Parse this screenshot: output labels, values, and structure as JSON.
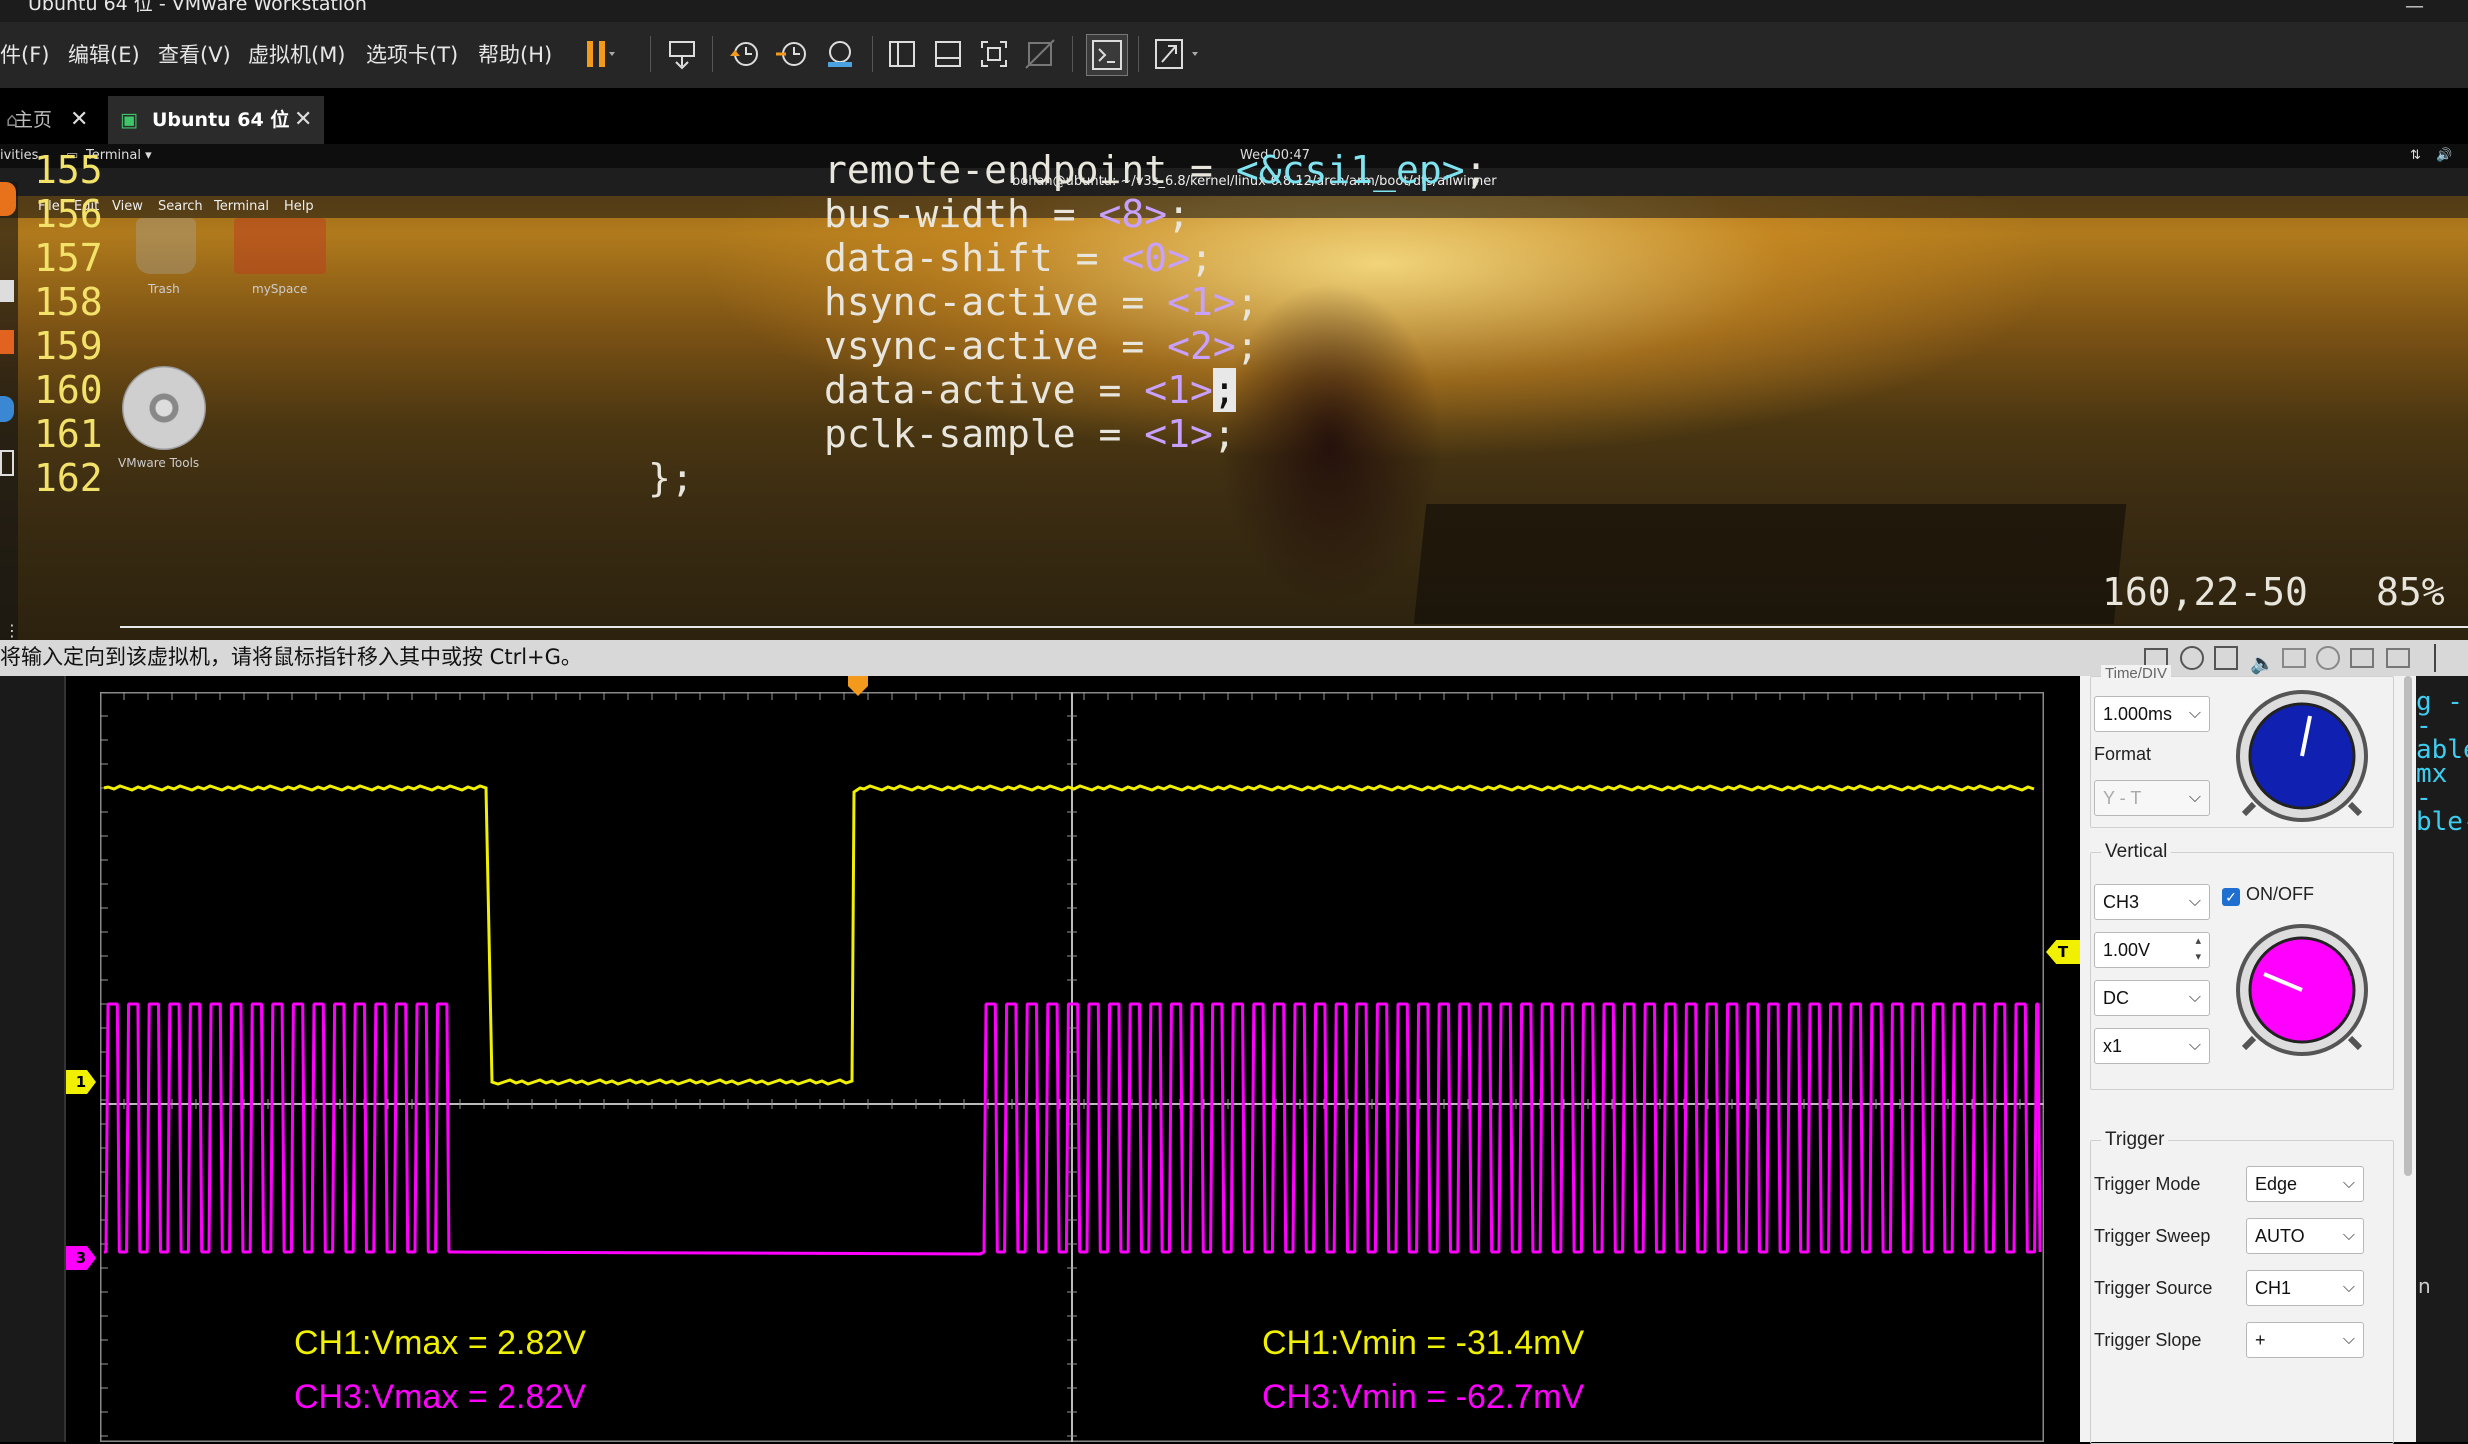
{
  "window": {
    "title": "Ubuntu 64 位 - VMware Workstation",
    "minimize_glyph": "—"
  },
  "menu": [
    "件(F)",
    "编辑(E)",
    "查看(V)",
    "虚拟机(M)",
    "选项卡(T)",
    "帮助(H)"
  ],
  "toolbar_icons": [
    "pause-icon",
    "send-ctrl-alt-del-icon",
    "snapshot-icon",
    "revert-snapshot-icon",
    "snapshot-manager-icon",
    "sidebar-view-icon",
    "thumbnail-view-icon",
    "fullscreen-icon",
    "unity-icon",
    "console-view-icon",
    "stretch-guest-icon"
  ],
  "tabs": [
    {
      "label": "主页",
      "active": false
    },
    {
      "label": "Ubuntu 64 位",
      "active": true
    }
  ],
  "ubuntu": {
    "activities": "ivities",
    "app_menu": "Terminal ▾",
    "clock": "Wed 00:47",
    "terminal_title": "bohan@ubuntu: ~/v3s_6.8/kernel/linux-6.8.12/arch/arm/boot/dts/allwinner",
    "terminal_menu": [
      "File",
      "Edit",
      "View",
      "Search",
      "Terminal",
      "Help"
    ],
    "desktop_icons": [
      "Trash",
      "mySpace",
      "VMware Tools"
    ]
  },
  "editor": {
    "lines": [
      {
        "num": "155",
        "indent": "        ",
        "key": "remote-endpoint = ",
        "val": "<&csi1_ep>",
        "end": ";"
      },
      {
        "num": "156",
        "indent": "        ",
        "key": "bus-width = ",
        "val": "<8>",
        "end": ";"
      },
      {
        "num": "157",
        "indent": "        ",
        "key": "data-shift = ",
        "val": "<0>",
        "end": ";"
      },
      {
        "num": "158",
        "indent": "        ",
        "key": "hsync-active = ",
        "val": "<1>",
        "end": ";"
      },
      {
        "num": "159",
        "indent": "        ",
        "key": "vsync-active = ",
        "val": "<2>",
        "end": ";"
      },
      {
        "num": "160",
        "indent": "        ",
        "key": "data-active = ",
        "val": "<1>",
        "end": ";"
      },
      {
        "num": "161",
        "indent": "        ",
        "key": "pclk-sample = ",
        "val": "<1>",
        "end": ";"
      },
      {
        "num": "162",
        "indent": "",
        "key": "};",
        "val": "",
        "end": ""
      }
    ],
    "position": "160,22-50",
    "percent": "85%"
  },
  "status_hint": "将输入定向到该虚拟机，请将鼠标指针移入其中或按 Ctrl+G。",
  "scope": {
    "ch1_color": "#f0f000",
    "ch3_color": "#ff00ff",
    "markers": {
      "ch1": "1",
      "ch3": "3",
      "trigger": "T"
    },
    "measurements": {
      "ch1_vmax": "CH1:Vmax = 2.82V",
      "ch3_vmax": "CH3:Vmax = 2.82V",
      "ch1_vmin": "CH1:Vmin = -31.4mV",
      "ch3_vmin": "CH3:Vmin = -62.7mV"
    }
  },
  "panel": {
    "time_div_label": "Time/DIV",
    "time_div_value": "1.000ms",
    "format_label": "Format",
    "format_value": "Y - T",
    "vertical_title": "Vertical",
    "channel": "CH3",
    "onoff_label": "ON/OFF",
    "volts": "1.00V",
    "coupling": "DC",
    "probe": "x1",
    "trigger_title": "Trigger",
    "trigger_mode_label": "Trigger Mode",
    "trigger_mode": "Edge",
    "trigger_sweep_label": "Trigger Sweep",
    "trigger_sweep": "AUTO",
    "trigger_source_label": "Trigger Source",
    "trigger_source": "CH1",
    "trigger_slope_label": "Trigger Slope",
    "trigger_slope": "+"
  },
  "right_edge_text": [
    "g --",
    "able",
    "mx -",
    "ble-"
  ],
  "right_edge_n": "n"
}
